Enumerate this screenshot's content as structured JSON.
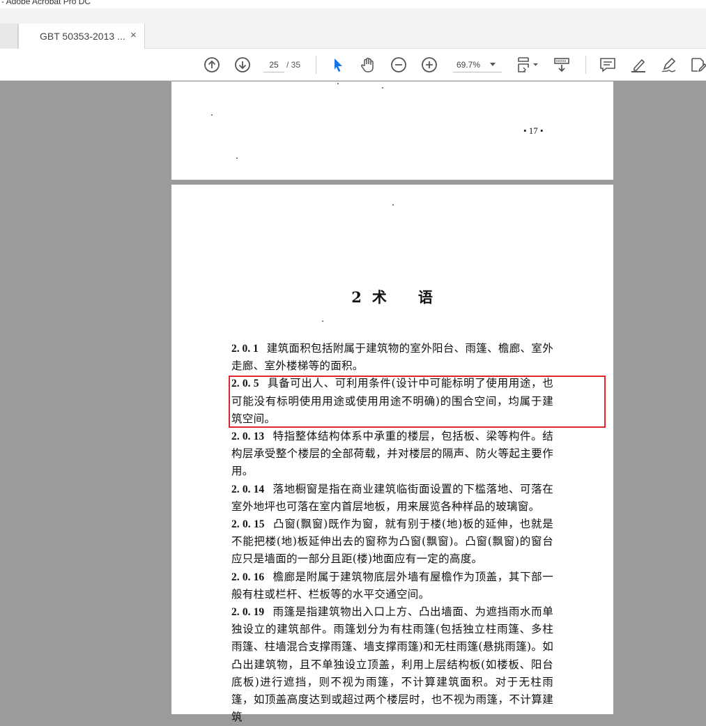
{
  "window": {
    "title": "- Adobe Acrobat Pro DC"
  },
  "tab": {
    "label": "GBT 50353-2013 ...",
    "close": "×"
  },
  "toolbar": {
    "current_page": "25",
    "total_pages": "/ 35",
    "zoom": "69.7%",
    "icons": [
      "prev-page-icon",
      "next-page-icon",
      "select-cursor-icon",
      "hand-icon",
      "zoom-out-icon",
      "zoom-in-icon",
      "page-display-icon",
      "scroll-mode-icon",
      "comment-icon",
      "highlight-pen-icon",
      "sign-icon",
      "edit-pdf-icon"
    ],
    "accent_color": "#1473e6"
  },
  "page1": {
    "page_number": "• 17 •"
  },
  "page2": {
    "chapter_number": "2",
    "chapter_title_1": "术",
    "chapter_title_2": "语",
    "clauses": [
      {
        "num": "2. 0. 1",
        "text": "建筑面积包括附属于建筑物的室外阳台、雨篷、檐廊、室外走廊、室外楼梯等的面积。"
      },
      {
        "num": "2. 0. 5",
        "text": "具备可出人、可利用条件(设计中可能标明了使用用途，也可能没有标明使用用途或使用用途不明确)的围合空间，均属于建筑空间。",
        "highlighted": true
      },
      {
        "num": "2. 0. 13",
        "text": "特指整体结构体系中承重的楼层，包括板、梁等构件。结构层承受整个楼层的全部荷载，并对楼层的隔声、防火等起主要作用。"
      },
      {
        "num": "2. 0. 14",
        "text": "落地橱窗是指在商业建筑临街面设置的下槛落地、可落在室外地坪也可落在室内首层地板，用来展览各种样品的玻璃窗。"
      },
      {
        "num": "2. 0. 15",
        "text": "凸窗(飘窗)既作为窗，就有别于楼(地)板的延伸，也就是不能把楼(地)板延伸出去的窗称为凸窗(飘窗)。凸窗(飘窗)的窗台应只是墙面的一部分且距(楼)地面应有一定的高度。"
      },
      {
        "num": "2. 0. 16",
        "text": "檐廊是附属于建筑物底层外墙有屋檐作为顶盖，其下部一般有柱或栏杆、栏板等的水平交通空间。"
      },
      {
        "num": "2. 0. 19",
        "text": "雨篷是指建筑物出入口上方、凸出墙面、为遮挡雨水而单独设立的建筑部件。雨篷划分为有柱雨篷(包括独立柱雨篷、多柱雨篷、柱墙混合支撑雨篷、墙支撑雨篷)和无柱雨篷(悬挑雨篷)。如凸出建筑物，且不单独设立顶盖，利用上层结构板(如楼板、阳台底板)进行遮挡，则不视为雨篷，不计算建筑面积。对于无柱雨篷，如顶盖高度达到或超过两个楼层时，也不视为雨篷，不计算建筑"
      }
    ],
    "highlight_color": "#e0242c"
  }
}
